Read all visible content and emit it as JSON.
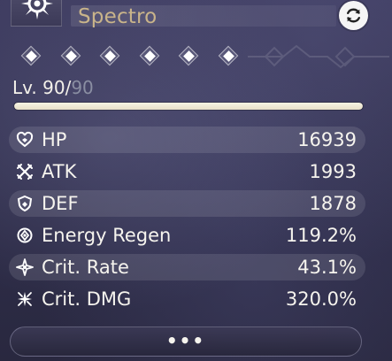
{
  "header": {
    "element_icon": "spectro-star-icon",
    "element_name": "Spectro",
    "refresh_icon": "refresh-icon"
  },
  "sequence": {
    "nodes": [
      {
        "icon": "diamond-node-icon"
      },
      {
        "icon": "diamond-node-icon"
      },
      {
        "icon": "diamond-node-icon"
      },
      {
        "icon": "diamond-node-icon"
      },
      {
        "icon": "diamond-node-icon"
      },
      {
        "icon": "diamond-node-icon"
      }
    ]
  },
  "level": {
    "label": "Lv. 90/",
    "max": "90",
    "progress_fraction": 1.0
  },
  "stats": [
    {
      "icon": "heart-icon",
      "label": "HP",
      "value": "16939",
      "shaded": true
    },
    {
      "icon": "crossed-swords-icon",
      "label": "ATK",
      "value": "1993",
      "shaded": false
    },
    {
      "icon": "shield-icon",
      "label": "DEF",
      "value": "1878",
      "shaded": true
    },
    {
      "icon": "energy-regen-icon",
      "label": "Energy Regen",
      "value": "119.2%",
      "shaded": false
    },
    {
      "icon": "crit-rate-icon",
      "label": "Crit. Rate",
      "value": "43.1%",
      "shaded": true
    },
    {
      "icon": "crit-dmg-icon",
      "label": "Crit. DMG",
      "value": "320.0%",
      "shaded": false
    }
  ],
  "more_button": {
    "label": "•••",
    "icon": "more-dots-icon"
  },
  "colors": {
    "element_text": "#c9b48a",
    "level_fill": "#efe9d3",
    "level_max_text": "#8a8ea2"
  }
}
